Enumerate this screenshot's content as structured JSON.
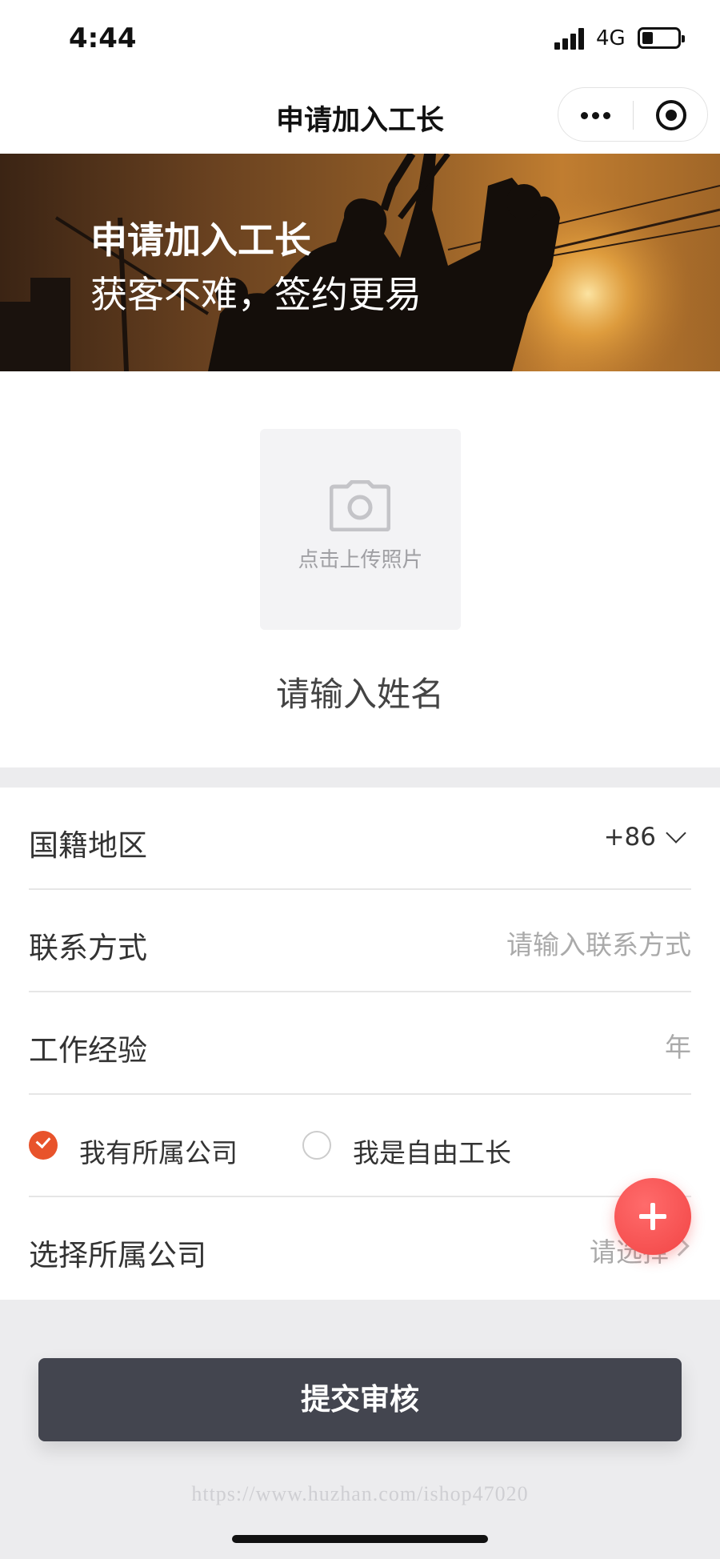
{
  "status_bar": {
    "time": "4:44",
    "network": "4G"
  },
  "nav": {
    "title": "申请加入工长",
    "more_icon": "more-dots-icon",
    "close_icon": "target-close-icon"
  },
  "banner": {
    "title": "申请加入工长",
    "subtitle": "获客不难，签约更易"
  },
  "profile": {
    "upload_label": "点击上传照片",
    "upload_icon": "camera-icon",
    "name_placeholder": "请输入姓名"
  },
  "form": {
    "region": {
      "label": "国籍地区",
      "value": "+86"
    },
    "contact": {
      "label": "联系方式",
      "placeholder": "请输入联系方式"
    },
    "experience": {
      "label": "工作经验",
      "unit": "年"
    },
    "affiliation": {
      "option_company": "我有所属公司",
      "option_freelance": "我是自由工长",
      "selected": "option_company"
    },
    "company": {
      "label": "选择所属公司",
      "placeholder": "请选择"
    }
  },
  "fab_icon": "plus-icon",
  "submit_label": "提交审核",
  "watermark": "https://www.huzhan.com/ishop47020",
  "colors": {
    "accent": "#e8532b",
    "button": "#43454f",
    "fab": "#f24545"
  }
}
